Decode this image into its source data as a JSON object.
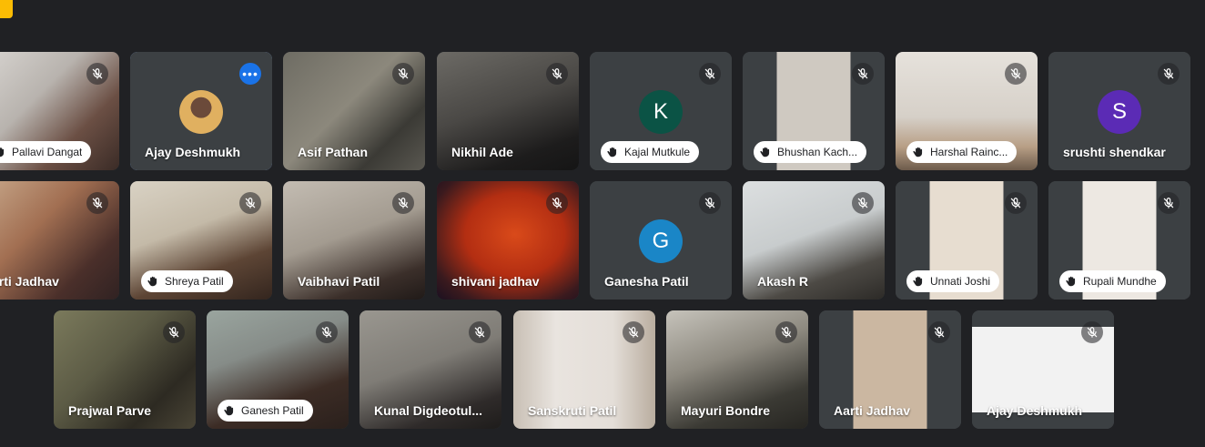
{
  "participants": [
    {
      "name": "Pallavi Dangat",
      "label": "pill",
      "bg": "linear-gradient(135deg,#d9d6d2 0%,#b8b3ae 40%,#6b4f44 70%,#3a2b26 100%)"
    },
    {
      "name": "Ajay Deshmukh",
      "label": "plain",
      "active": true,
      "avatar_type": "photo",
      "bg": "#3c4043"
    },
    {
      "name": "Asif Pathan",
      "label": "plain",
      "bg": "linear-gradient(135deg,#6e6c63 0%,#8c887c 45%,#3b3a35 75%,#5a5851 100%)"
    },
    {
      "name": "Nikhil Ade",
      "label": "plain",
      "bg": "linear-gradient(160deg,#6c6a65 0%,#4a4845 45%,#1d1c1c 80%,#151515 100%)"
    },
    {
      "name": "Kajal Mutkule",
      "label": "pill",
      "avatar_letter": "K",
      "avatar_color": "#0b5345",
      "bg": "#3c4043"
    },
    {
      "name": "Bhushan Kach...",
      "label": "pill",
      "bg": "linear-gradient(90deg,#3c4043 0 24%,#cfc9c1 24% 76%,#3c4043 76% 100%)"
    },
    {
      "name": "Harshal Rainc...",
      "label": "pill",
      "bg": "linear-gradient(180deg,#e6e2dc 0%,#d6d0c8 55%,#b89f86 80%,#6d5b4b 100%)"
    },
    {
      "name": "srushti shendkar",
      "label": "plain",
      "avatar_letter": "S",
      "avatar_color": "#5b2bb5",
      "bg": "#3c4043"
    },
    {
      "name": "arti Jadhav",
      "label": "plain",
      "bg": "linear-gradient(135deg,#c8a98c 0%,#a26f52 40%,#4a2f2a 75%,#302222 100%)"
    },
    {
      "name": "Shreya Patil",
      "label": "pill",
      "bg": "linear-gradient(160deg,#d9d2c4 0%,#c4baa8 40%,#5d4535 70%,#33251e 100%)"
    },
    {
      "name": "Vaibhavi Patil",
      "label": "plain",
      "bg": "linear-gradient(160deg,#c3bcb2 0%,#a39b90 45%,#3b2f2a 80%,#201a18 100%)"
    },
    {
      "name": "shivani jadhav",
      "label": "plain",
      "bg": "radial-gradient(ellipse at 55% 45%,#d94a1a 0%,#b32e12 45%,#3a1a1e 80%,#1a1020 100%)"
    },
    {
      "name": "Ganesha Patil",
      "label": "plain",
      "avatar_letter": "G",
      "avatar_color": "#1a86c7",
      "bg": "#3c4043"
    },
    {
      "name": "Akash R",
      "label": "plain",
      "bg": "linear-gradient(160deg,#dcdfe0 0%,#c8cccd 45%,#4d4a45 75%,#2c2a27 100%)"
    },
    {
      "name": "Unnati Joshi",
      "label": "pill",
      "bg": "linear-gradient(90deg,#3c4043 0 24%,#e7ddd0 24% 76%,#3c4043 76% 100%)"
    },
    {
      "name": "Rupali Mundhe",
      "label": "pill",
      "bg": "linear-gradient(90deg,#3c4043 0 24%,#ede8e2 24% 76%,#3c4043 76% 100%)"
    },
    {
      "name": "Prajwal Parve",
      "label": "plain",
      "bg": "linear-gradient(135deg,#7b7a5c 0%,#5c5b45 40%,#2d2a22 75%,#4a4536 100%)"
    },
    {
      "name": "Ganesh Patil",
      "label": "pill",
      "bg": "linear-gradient(160deg,#9aa59f 0%,#868c88 35%,#3c2c25 70%,#2a201c 100%)"
    },
    {
      "name": "Kunal Digdeotul...",
      "label": "plain",
      "bg": "linear-gradient(160deg,#9a9790 0%,#7f7c76 45%,#2f2b2a 80%,#1e1c1b 100%)"
    },
    {
      "name": "Sanskruti Patil",
      "label": "plain",
      "bg": "linear-gradient(90deg,#c8bfb4 0%,#e9e4df 30%,#e4ded8 70%,#b9ad9f 100%)"
    },
    {
      "name": "Mayuri Bondre",
      "label": "plain",
      "bg": "linear-gradient(160deg,#c6c3bb 0%,#8e8a80 40%,#3b3a34 75%,#262521 100%)"
    },
    {
      "name": "Aarti Jadhav",
      "label": "plain",
      "bg": "linear-gradient(90deg,#3c4043 0 24%,#cbb7a1 24% 76%,#3c4043 76% 100%)"
    },
    {
      "name": "Ajay Deshmukh",
      "label": "plain",
      "bg": "linear-gradient(180deg,#3c4043 0 14%,#f2f2f2 14% 86%,#3c4043 86% 100%)"
    }
  ]
}
